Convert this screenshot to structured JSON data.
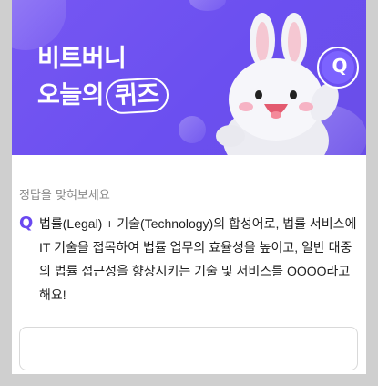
{
  "banner": {
    "title_line1": "비트버니",
    "title_line2_prefix": "오늘의",
    "title_line2_highlight": "퀴즈",
    "mascot_badge": "Q",
    "background_color": "#6b4ff0"
  },
  "quiz": {
    "hint": "정답을 맞혀보세요",
    "question_marker": "Q",
    "question_text": "법률(Legal) + 기술(Technology)의 합성어로, 법률 서비스에 IT 기술을 접목하여 법률 업무의 효율성을 높이고, 일반 대중의 법률 접근성을 향상시키는 기술 및 서비스를 OOOO라고 해요!",
    "answer_value": "",
    "answer_placeholder": ""
  },
  "icons": [
    "rabbit-mascot",
    "q-badge-icon",
    "coin-decoration"
  ]
}
